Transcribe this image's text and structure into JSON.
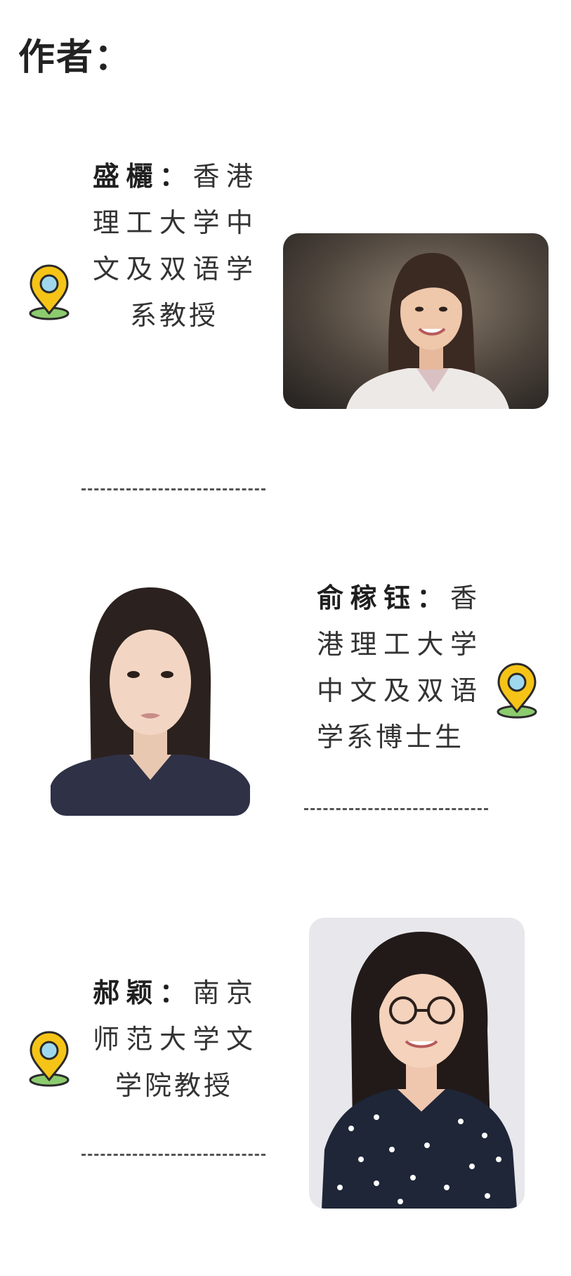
{
  "page": {
    "heading": "作者："
  },
  "authors": [
    {
      "name": "盛欐：",
      "desc": "香港理工大学中文及双语学系教授",
      "icon": "location-pin-icon"
    },
    {
      "name": "俞稼钰：",
      "desc": "香港理工大学中文及双语学系博士生",
      "icon": "location-pin-icon"
    },
    {
      "name": "郝颖：",
      "desc": "南京师范大学文学院教授",
      "icon": "location-pin-icon"
    }
  ],
  "colors": {
    "pin_yellow": "#F6C417",
    "pin_center": "#9FD8EE",
    "pin_base": "#8CCB6E",
    "outline": "#2a2a2a"
  }
}
